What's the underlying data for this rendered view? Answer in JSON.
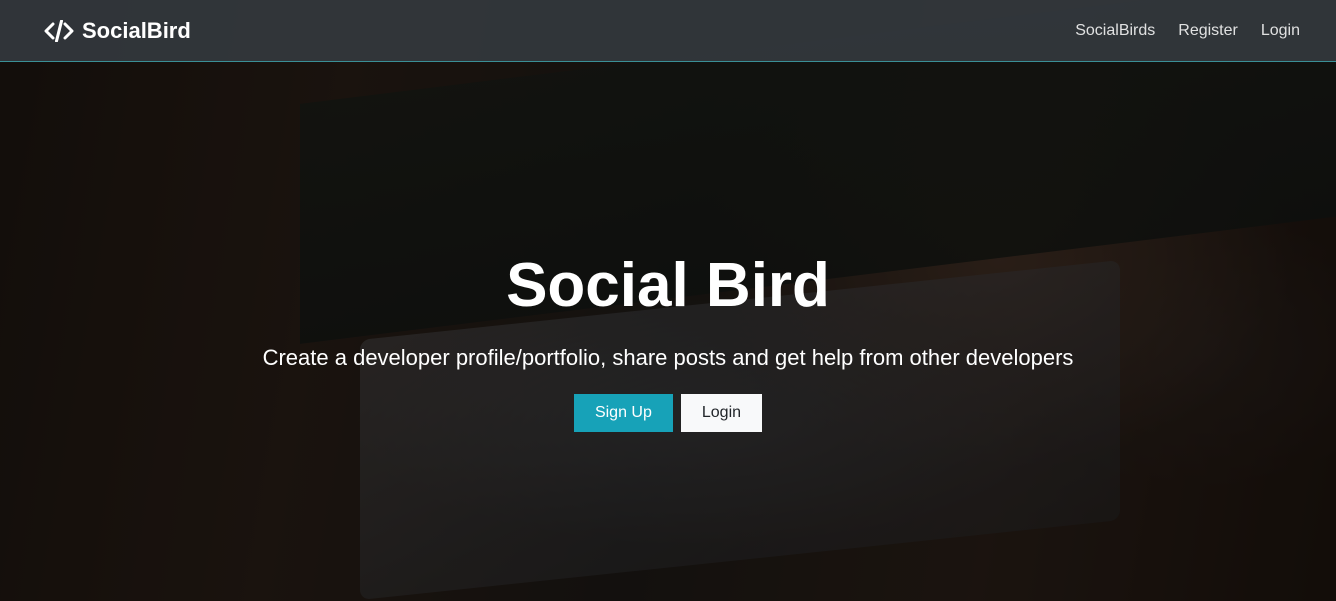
{
  "navbar": {
    "brand": "SocialBird",
    "brand_icon": "code-icon",
    "links": [
      {
        "label": "SocialBirds"
      },
      {
        "label": "Register"
      },
      {
        "label": "Login"
      }
    ]
  },
  "hero": {
    "title": "Social Bird",
    "lead": "Create a developer profile/portfolio, share posts and get help from other developers",
    "buttons": {
      "signup": "Sign Up",
      "login": "Login"
    }
  },
  "colors": {
    "navbar_bg": "#343a40",
    "accent": "#17a2b8",
    "light_button": "#f8f9fa"
  }
}
